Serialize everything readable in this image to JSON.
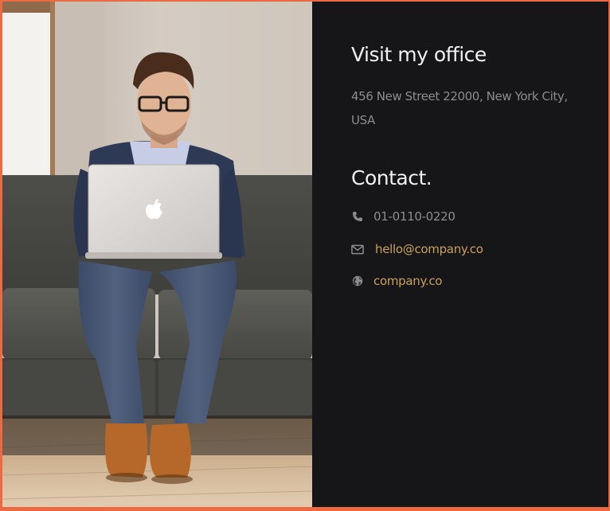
{
  "photo": {
    "alt": "Man with glasses working on a laptop while sitting on a grey sofa"
  },
  "office": {
    "title": "Visit my office",
    "address": "456 New Street 22000, New York City, USA"
  },
  "contact": {
    "title": "Contact.",
    "phone": {
      "icon": "phone-icon",
      "text": "01-0110-0220"
    },
    "email": {
      "icon": "envelope-icon",
      "text": "hello@company.co"
    },
    "website": {
      "icon": "globe-icon",
      "text": "company.co"
    }
  },
  "colors": {
    "accent_border": "#ec6a43",
    "panel_background": "#161517",
    "heading_text": "#f1f1f1",
    "muted_text": "#8d8b8c",
    "link_text": "#c8a15c"
  }
}
